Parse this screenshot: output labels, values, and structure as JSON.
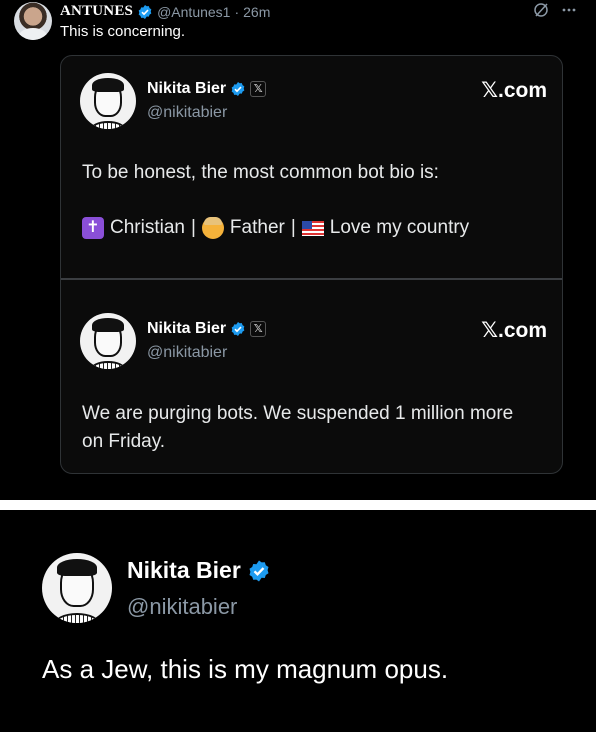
{
  "top_tweet": {
    "display_name": "ANTUNES",
    "handle": "@Antunes1",
    "separator": "·",
    "time": "26m",
    "text": "This is concerning."
  },
  "embed1": {
    "display_name": "Nikita Bier",
    "handle": "@nikitabier",
    "brand": "𝕏.com",
    "affiliate_badge": "𝕏",
    "text": "To be honest, the most common bot bio is:",
    "bio_items": [
      "Christian",
      "Father",
      "Love my country"
    ],
    "bio_separator": "|"
  },
  "embed2": {
    "display_name": "Nikita Bier",
    "handle": "@nikitabier",
    "brand": "𝕏.com",
    "affiliate_badge": "𝕏",
    "text_line1": "We are purging bots. We suspended 1 million more",
    "text_line2": "on Friday."
  },
  "bottom_post": {
    "display_name": "Nikita Bier",
    "handle": "@nikitabier",
    "text": "As a Jew, this is my magnum opus."
  },
  "icons": {
    "verified": "verified-badge-icon",
    "grok": "grok-icon",
    "more": "more-icon"
  },
  "colors": {
    "verified_blue": "#1d9bf0",
    "background": "#000000",
    "muted_text": "#8b98a5",
    "card_border": "#2f3336"
  }
}
